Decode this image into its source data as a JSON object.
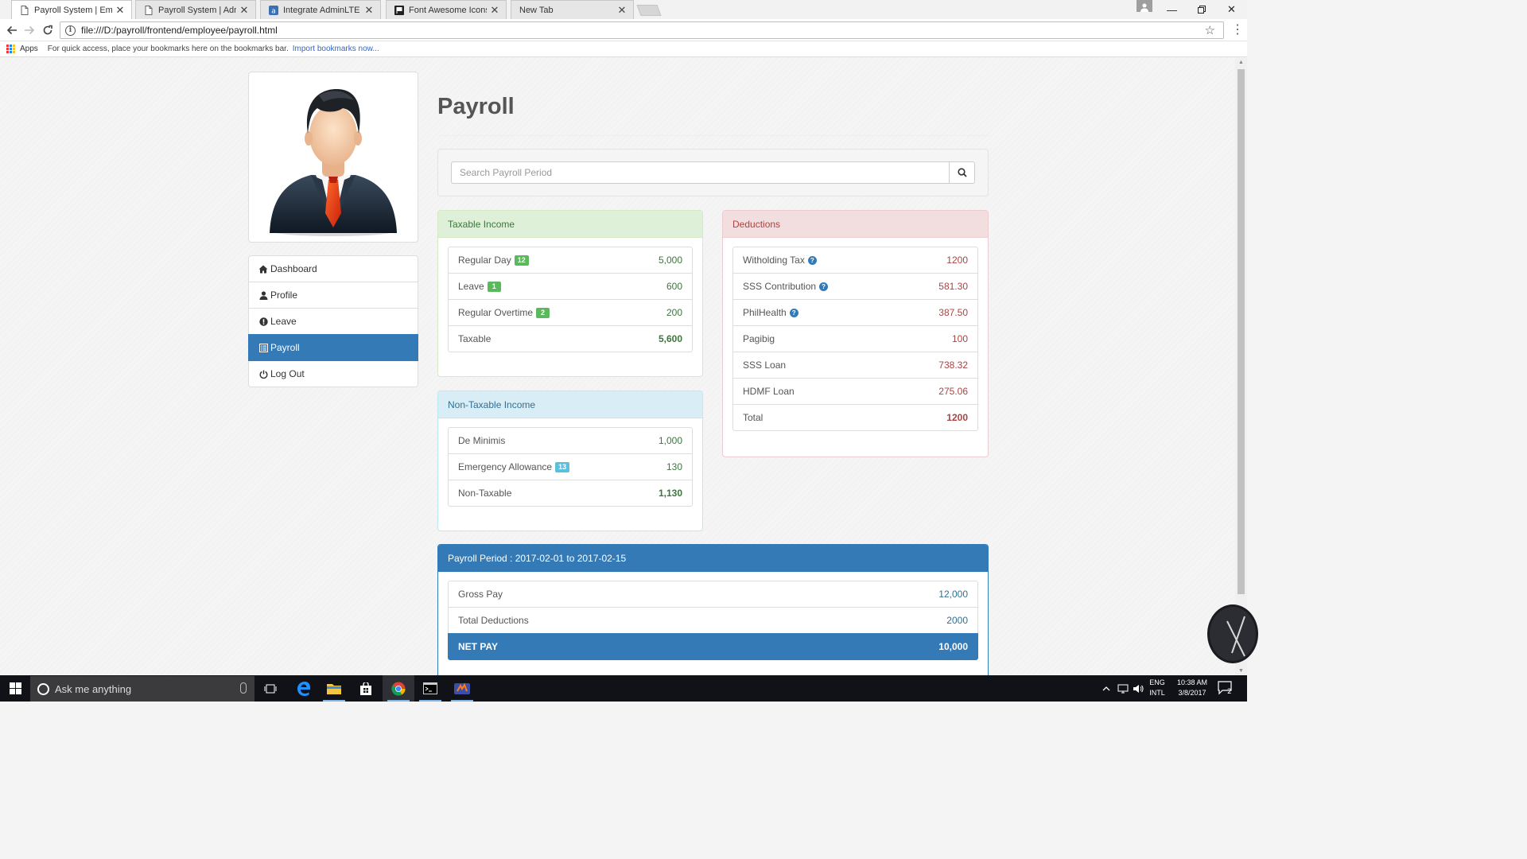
{
  "browser": {
    "tabs": [
      {
        "title": "Payroll System | Employee",
        "active": true
      },
      {
        "title": "Payroll System | Administrator",
        "active": false
      },
      {
        "title": "Integrate AdminLTE with",
        "active": false
      },
      {
        "title": "Font Awesome Icons",
        "active": false
      },
      {
        "title": "New Tab",
        "active": false
      }
    ],
    "url": "file:///D:/payroll/frontend/employee/payroll.html",
    "bookmarks": {
      "apps_label": "Apps",
      "hint": "For quick access, place your bookmarks here on the bookmarks bar.",
      "import_link": "Import bookmarks now..."
    }
  },
  "sidebar": {
    "items": [
      {
        "label": "Dashboard",
        "icon": "home-icon"
      },
      {
        "label": "Profile",
        "icon": "user-icon"
      },
      {
        "label": "Leave",
        "icon": "exclamation-circle-icon"
      },
      {
        "label": "Payroll",
        "icon": "list-alt-icon",
        "active": true
      },
      {
        "label": "Log Out",
        "icon": "power-off-icon"
      }
    ]
  },
  "page": {
    "title": "Payroll",
    "search_placeholder": "Search Payroll Period"
  },
  "taxable": {
    "heading": "Taxable Income",
    "rows": [
      {
        "label": "Regular Day",
        "badge": "12",
        "value": "5,000"
      },
      {
        "label": "Leave",
        "badge": "1",
        "value": "600"
      },
      {
        "label": "Regular Overtime",
        "badge": "2",
        "value": "200"
      }
    ],
    "total_label": "Taxable",
    "total_value": "5,600"
  },
  "non_taxable": {
    "heading": "Non-Taxable Income",
    "rows": [
      {
        "label": "De Minimis",
        "badge": "",
        "value": "1,000"
      },
      {
        "label": "Emergency Allowance",
        "badge": "13",
        "value": "130"
      }
    ],
    "total_label": "Non-Taxable",
    "total_value": "1,130"
  },
  "deductions": {
    "heading": "Deductions",
    "rows": [
      {
        "label": "Witholding Tax",
        "help": true,
        "value": "1200"
      },
      {
        "label": "SSS Contribution",
        "help": true,
        "value": "581.30"
      },
      {
        "label": "PhilHealth",
        "help": true,
        "value": "387.50"
      },
      {
        "label": "Pagibig",
        "help": false,
        "value": "100"
      },
      {
        "label": "SSS Loan",
        "help": false,
        "value": "738.32"
      },
      {
        "label": "HDMF Loan",
        "help": false,
        "value": "275.06"
      }
    ],
    "total_label": "Total",
    "total_value": "1200"
  },
  "summary": {
    "heading": "Payroll Period : 2017-02-01 to 2017-02-15",
    "gross_label": "Gross Pay",
    "gross_value": "12,000",
    "deductions_label": "Total Deductions",
    "deductions_value": "2000",
    "net_label": "NET PAY",
    "net_value": "10,000"
  },
  "taskbar": {
    "search_text": "Ask me anything",
    "lang": "ENG",
    "lang_sub": "INTL",
    "time": "10:38 AM",
    "date": "3/8/2017",
    "notif_count": "2"
  },
  "colors": {
    "primary": "#337ab7",
    "success_bg": "#dff0d8",
    "info_bg": "#d9edf7",
    "danger_bg": "#f2dede"
  }
}
